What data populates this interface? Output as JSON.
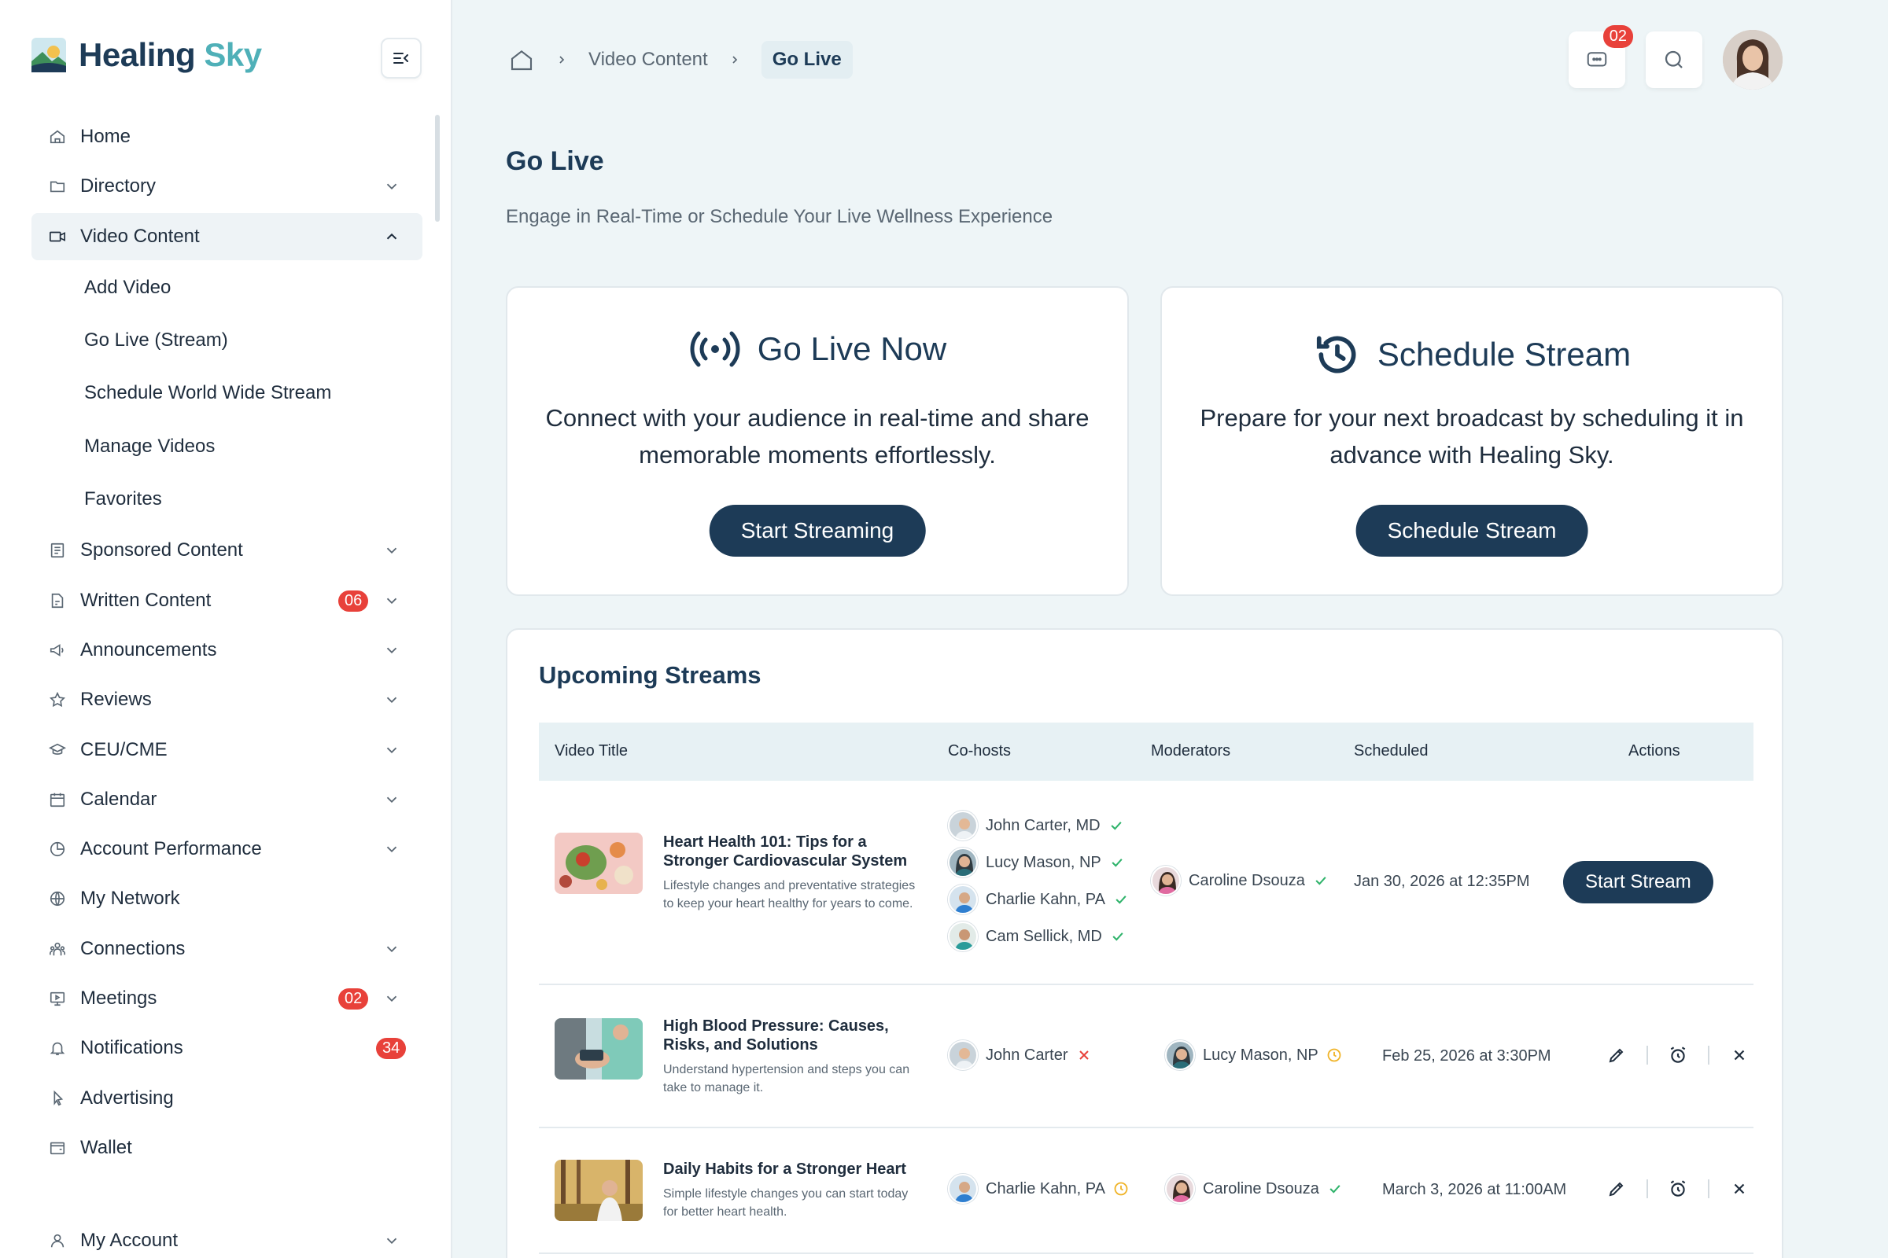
{
  "app": {
    "brand_part1": "Healing",
    "brand_part2": "Sky"
  },
  "sidebar": {
    "items": [
      {
        "label": "Home"
      },
      {
        "label": "Directory"
      },
      {
        "label": "Video Content"
      },
      {
        "label": "Sponsored Content"
      },
      {
        "label": "Written Content",
        "badge": "06"
      },
      {
        "label": "Announcements"
      },
      {
        "label": "Reviews"
      },
      {
        "label": "CEU/CME"
      },
      {
        "label": "Calendar"
      },
      {
        "label": "Account Performance"
      },
      {
        "label": "My Network"
      },
      {
        "label": "Connections"
      },
      {
        "label": "Meetings",
        "badge": "02"
      },
      {
        "label": "Notifications",
        "badge": "34"
      },
      {
        "label": "Advertising"
      },
      {
        "label": "Wallet"
      }
    ],
    "video_sub": [
      "Add Video",
      "Go Live (Stream)",
      "Schedule World Wide Stream",
      "Manage Videos",
      "Favorites"
    ],
    "my_account": "My Account"
  },
  "header": {
    "breadcrumb": [
      "Video Content",
      "Go Live"
    ],
    "messages_badge": "02"
  },
  "page": {
    "title": "Go Live",
    "subtitle": "Engage in Real-Time or Schedule Your Live Wellness Experience"
  },
  "cards": {
    "live": {
      "title": "Go Live Now",
      "desc": "Connect with your audience in real-time and share memorable moments effortlessly.",
      "button": "Start Streaming"
    },
    "schedule": {
      "title": "Schedule Stream",
      "desc": "Prepare for your next broadcast by scheduling it in advance with Healing Sky.",
      "button": "Schedule Stream"
    }
  },
  "streams": {
    "title": "Upcoming Streams",
    "columns": [
      "Video Title",
      "Co-hosts",
      "Moderators",
      "Scheduled",
      "Actions"
    ],
    "rows": [
      {
        "title": "Heart Health 101: Tips for a Stronger Cardiovascular System",
        "desc": "Lifestyle changes and preventative strategies to keep your heart healthy for years to come.",
        "cohosts": [
          {
            "name": "John Carter, MD",
            "status": "confirmed"
          },
          {
            "name": "Lucy Mason, NP",
            "status": "confirmed"
          },
          {
            "name": "Charlie Kahn, PA",
            "status": "confirmed"
          },
          {
            "name": "Cam Sellick, MD",
            "status": "confirmed"
          }
        ],
        "moderator": {
          "name": "Caroline Dsouza",
          "status": "confirmed"
        },
        "scheduled": "Jan 30, 2026 at 12:35PM",
        "action": "Start Stream"
      },
      {
        "title": "High Blood Pressure: Causes, Risks, and Solutions",
        "desc": "Understand hypertension and steps you can take to manage it.",
        "cohosts": [
          {
            "name": "John Carter",
            "status": "declined"
          }
        ],
        "moderator": {
          "name": "Lucy Mason, NP",
          "status": "pending"
        },
        "scheduled": "Feb 25, 2026 at 3:30PM"
      },
      {
        "title": "Daily Habits for a Stronger Heart",
        "desc": "Simple lifestyle changes you can start today for better heart health.",
        "cohosts": [
          {
            "name": "Charlie Kahn, PA",
            "status": "pending"
          }
        ],
        "moderator": {
          "name": "Caroline Dsouza",
          "status": "confirmed"
        },
        "scheduled": "March 3, 2026 at 11:00AM"
      }
    ]
  },
  "colors": {
    "primary": "#1d3b57",
    "accent": "#4fb0b8",
    "danger": "#e8413a",
    "success": "#2fb36b",
    "warning": "#f0b429",
    "background": "#eef5f7"
  }
}
